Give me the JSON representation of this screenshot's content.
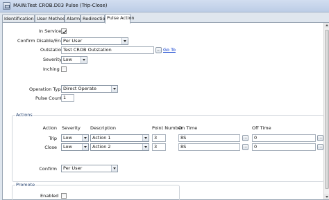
{
  "window": {
    "title": "MAIN:Test CROB.D03 Pulse (Trip-Close)"
  },
  "tabs": [
    "Identification",
    "User Methods",
    "Alarm",
    "Redirection",
    "Pulse Action"
  ],
  "form": {
    "in_service_label": "In Service",
    "in_service_checked": true,
    "confirm_label": "Confirm Disable/Enable",
    "confirm_value": "Per User",
    "outstation_label": "Outstation",
    "outstation_value": "Test CROB Outstation",
    "dots": "...",
    "goto_label": "Go To",
    "severity_label": "Severity",
    "severity_value": "Low",
    "inching_label": "Inching",
    "inching_checked": false,
    "operation_type_label": "Operation Type",
    "operation_type_value": "Direct Operate",
    "pulse_count_label": "Pulse Count",
    "pulse_count_value": "1"
  },
  "actions": {
    "group_title": "Actions",
    "headers": {
      "action": "Action",
      "severity": "Severity",
      "description": "Description",
      "point_number": "Point Number",
      "on_time": "On Time",
      "off_time": "Off Time"
    },
    "rows": [
      {
        "action": "Trip",
        "severity": "Low",
        "description": "Action 1",
        "point_number": "3",
        "on_time": "8S",
        "off_time": "0"
      },
      {
        "action": "Close",
        "severity": "Low",
        "description": "Action 2",
        "point_number": "3",
        "on_time": "8S",
        "off_time": "0"
      }
    ],
    "confirm_label": "Confirm",
    "confirm_value": "Per User"
  },
  "promote": {
    "group_title": "Promote",
    "enabled_label": "Enabled",
    "enabled_checked": false
  }
}
